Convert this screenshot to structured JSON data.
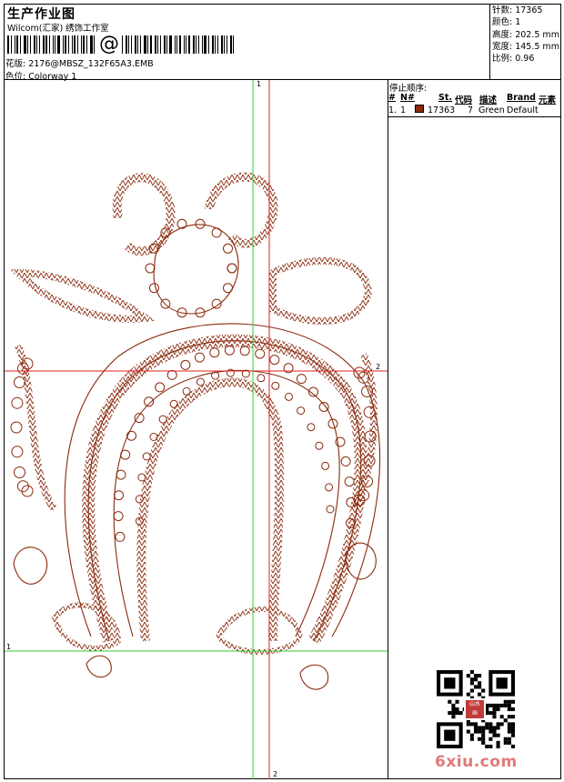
{
  "header": {
    "title": "生产作业图",
    "company": "Wilcom(汇家) 绣饰工作室",
    "barcode_symbol": "@",
    "design_file": "花版: 2176@MBSZ_132F65A3.EMB",
    "colorway": "色位: Colorway 1"
  },
  "stats": {
    "stitches": "针数: 17365",
    "colors": "颜色: 1",
    "height": "高度: 202.5 mm",
    "width": "宽度: 145.5 mm",
    "scale": "比例: 0.96"
  },
  "sequence": {
    "title": "停止顺序:",
    "headers": {
      "stop": "#",
      "no": "N#",
      "st": "St.",
      "code": "代码",
      "desc": "描述",
      "brand": "Brand",
      "elements": "元素"
    },
    "rows": [
      {
        "stop": "1.",
        "no": "1",
        "swatch": "#8a2a0d",
        "st": "17363",
        "code": "7",
        "desc": "Green",
        "brand": "Default"
      }
    ]
  },
  "guides": {
    "green_vertical_label": "1",
    "red_horizontal_label": "2",
    "green_horizontal_label": "1",
    "red_vertical_label": "2"
  },
  "design": {
    "thread_color": "#8a2a0d",
    "guide_green": "#33cc33",
    "guide_red": "#dd2222"
  },
  "watermark": "6xiu.com",
  "qr_stamp": [
    "山水",
    "画"
  ]
}
